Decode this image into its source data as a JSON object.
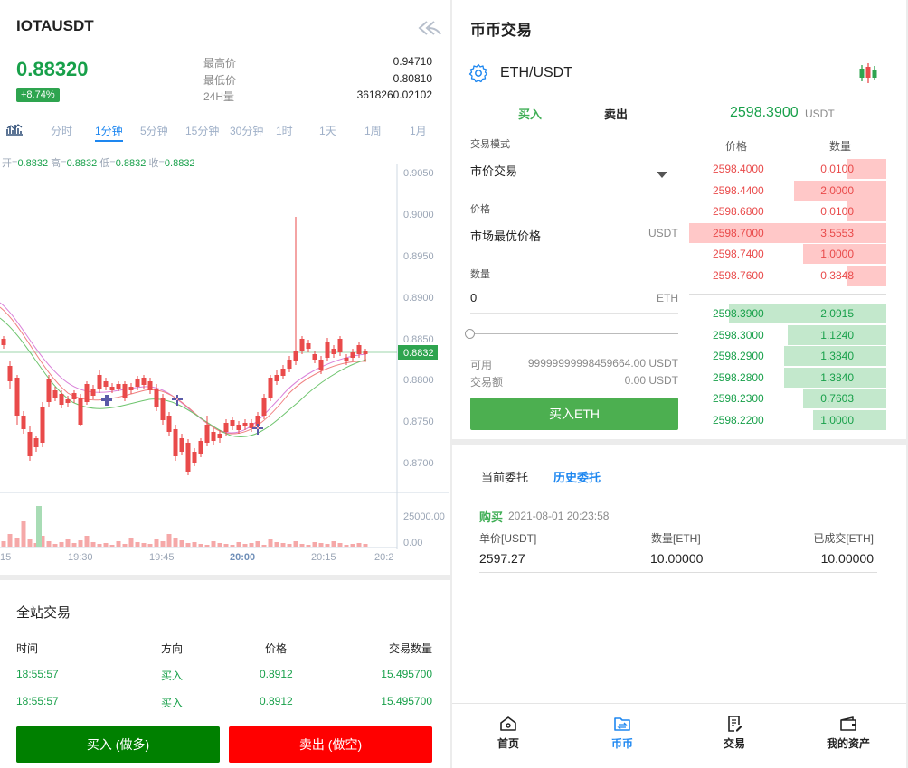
{
  "left": {
    "symbol": "IOTAUSDT",
    "last_price": "0.88320",
    "change": "+8.74%",
    "stats": [
      {
        "label": "最高价",
        "value": "0.94710"
      },
      {
        "label": "最低价",
        "value": "0.80810"
      },
      {
        "label": "24H量",
        "value": "3618260.02102"
      }
    ],
    "timeframes": [
      "分时",
      "1分钟",
      "5分钟",
      "15分钟",
      "30分钟",
      "1时",
      "1天",
      "1周",
      "1月"
    ],
    "active_timeframe": "1分钟",
    "ohlc": {
      "open_label": "开=",
      "open": "0.8832",
      "high_label": "高=",
      "high": "0.8832",
      "low_label": "低=",
      "low": "0.8832",
      "close_label": "收=",
      "close": "0.8832"
    },
    "price_axis": [
      "0.9050",
      "0.9000",
      "0.8950",
      "0.8900",
      "0.8850",
      "0.8800",
      "0.8750",
      "0.8700"
    ],
    "current_price_tag": "0.8832",
    "volume_axis": [
      "25000.00",
      "0.00"
    ],
    "time_axis": [
      "15",
      "19:30",
      "19:45",
      "20:00",
      "20:15",
      "20:2"
    ],
    "market_title": "全站交易",
    "market_headers": [
      "时间",
      "方向",
      "价格",
      "交易数量"
    ],
    "market_rows": [
      {
        "time": "18:55:57",
        "side": "买入",
        "price": "0.8912",
        "qty": "15.495700"
      },
      {
        "time": "18:55:57",
        "side": "买入",
        "price": "0.8912",
        "qty": "15.495700"
      }
    ],
    "buy_button": "买入 (做多)",
    "sell_button": "卖出 (做空)"
  },
  "right": {
    "page_title": "币币交易",
    "pair": "ETH/USDT",
    "tabs": {
      "buy": "买入",
      "sell": "卖出"
    },
    "last_price": "2598.3900",
    "last_price_unit": "USDT",
    "form": {
      "mode_label": "交易模式",
      "mode_value": "市价交易",
      "price_label": "价格",
      "price_value": "市场最优价格",
      "price_unit": "USDT",
      "qty_label": "数量",
      "qty_value": "0",
      "qty_unit": "ETH",
      "available_label": "可用",
      "available_value": "99999999998459664.00 USDT",
      "amount_label": "交易额",
      "amount_value": "0.00 USDT",
      "submit": "买入ETH"
    },
    "orderbook": {
      "headers": [
        "价格",
        "数量"
      ],
      "asks": [
        {
          "price": "2598.4000",
          "qty": "0.0100",
          "depth": 0.2
        },
        {
          "price": "2598.4400",
          "qty": "2.0000",
          "depth": 0.47
        },
        {
          "price": "2598.6800",
          "qty": "0.0100",
          "depth": 0.2
        },
        {
          "price": "2598.7000",
          "qty": "3.5553",
          "depth": 1.0
        },
        {
          "price": "2598.7400",
          "qty": "1.0000",
          "depth": 0.42
        },
        {
          "price": "2598.7600",
          "qty": "0.3848",
          "depth": 0.2
        }
      ],
      "bids": [
        {
          "price": "2598.3900",
          "qty": "2.0915",
          "depth": 0.8
        },
        {
          "price": "2598.3000",
          "qty": "1.1240",
          "depth": 0.5
        },
        {
          "price": "2598.2900",
          "qty": "1.3840",
          "depth": 0.52
        },
        {
          "price": "2598.2800",
          "qty": "1.3840",
          "depth": 0.52
        },
        {
          "price": "2598.2300",
          "qty": "0.7603",
          "depth": 0.42
        },
        {
          "price": "2598.2200",
          "qty": "1.0000",
          "depth": 0.37
        }
      ]
    },
    "orders_tabs": {
      "current": "当前委托",
      "history": "历史委托"
    },
    "order": {
      "side": "购买",
      "time": "2021-08-01 20:23:58",
      "headers": [
        "单价[USDT]",
        "数量[ETH]",
        "已成交[ETH]"
      ],
      "price": "2597.27",
      "qty": "10.00000",
      "filled": "10.00000"
    },
    "nav": [
      "首页",
      "币币",
      "交易",
      "我的资产"
    ]
  },
  "colors": {
    "up": "#18a04a",
    "down": "#e94a4a",
    "accent": "#1e87f0",
    "buy_button": "#008000",
    "sell_button": "#ff0000",
    "form_button": "#4caf50"
  }
}
